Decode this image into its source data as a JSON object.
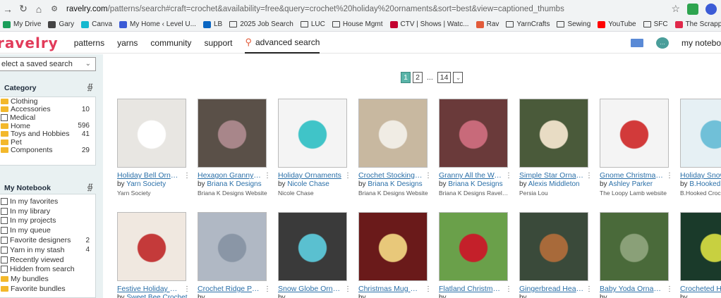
{
  "browser": {
    "url_host": "ravelry.com",
    "url_path": "/patterns/search#craft=crochet&availability=free&query=crochet%20holiday%20ornaments&sort=best&view=captioned_thumbs"
  },
  "bookmarks": [
    {
      "label": "My Drive",
      "color": "#1a9e5a",
      "folder": false
    },
    {
      "label": "Gary",
      "color": "#444",
      "folder": false
    },
    {
      "label": "Canva",
      "color": "#15b8cf",
      "folder": false
    },
    {
      "label": "My Home ‹ Level U...",
      "color": "#3b5bd6",
      "folder": false
    },
    {
      "label": "LB",
      "color": "#0a66c2",
      "folder": false
    },
    {
      "label": "2025 Job Search",
      "color": "",
      "folder": true
    },
    {
      "label": "LUC",
      "color": "",
      "folder": true
    },
    {
      "label": "House Mgmt",
      "color": "",
      "folder": true
    },
    {
      "label": "CTV | Shows | Watc...",
      "color": "#c3002f",
      "folder": false
    },
    {
      "label": "Rav",
      "color": "#e25b3a",
      "folder": false
    },
    {
      "label": "YarnCrafts",
      "color": "",
      "folder": true
    },
    {
      "label": "Sewing",
      "color": "",
      "folder": true
    },
    {
      "label": "YouTube",
      "color": "#ff0000",
      "folder": false
    },
    {
      "label": "SFC",
      "color": "",
      "folder": true
    },
    {
      "label": "The Scrappy Flower...",
      "color": "#e0284a",
      "folder": false
    }
  ],
  "header": {
    "logo": "ravelry",
    "nav": [
      "patterns",
      "yarns",
      "community",
      "support"
    ],
    "advanced_search": "advanced search",
    "notebook": "my notebo"
  },
  "sidebar": {
    "saved_search_placeholder": "elect a saved search",
    "category_title": "Category",
    "categories": [
      {
        "label": "Clothing",
        "count": "",
        "icon": "folder"
      },
      {
        "label": "Accessories",
        "count": "10",
        "icon": "folder"
      },
      {
        "label": "Medical",
        "count": "",
        "icon": "checkbox"
      },
      {
        "label": "Home",
        "count": "596",
        "icon": "folder"
      },
      {
        "label": "Toys and Hobbies",
        "count": "41",
        "icon": "folder"
      },
      {
        "label": "Pet",
        "count": "",
        "icon": "folder"
      },
      {
        "label": "Components",
        "count": "29",
        "icon": "folder"
      }
    ],
    "notebook_title": "My Notebook",
    "notebook_items": [
      {
        "label": "In my favorites",
        "count": "",
        "icon": "checkbox"
      },
      {
        "label": "In my library",
        "count": "",
        "icon": "checkbox"
      },
      {
        "label": "In my projects",
        "count": "",
        "icon": "checkbox"
      },
      {
        "label": "In my queue",
        "count": "",
        "icon": "checkbox"
      },
      {
        "label": "Favorite designers",
        "count": "2",
        "icon": "checkbox"
      },
      {
        "label": "Yarn in my stash",
        "count": "4",
        "icon": "checkbox"
      },
      {
        "label": "Recently viewed",
        "count": "",
        "icon": "checkbox"
      },
      {
        "label": "Hidden from search",
        "count": "",
        "icon": "checkbox"
      },
      {
        "label": "My bundles",
        "count": "",
        "icon": "folder"
      },
      {
        "label": "Favorite bundles",
        "count": "",
        "icon": "folder"
      }
    ]
  },
  "pagination": {
    "pages": [
      "1",
      "2"
    ],
    "ellipsis": "...",
    "last": "14"
  },
  "patterns": [
    {
      "title": "Holiday Bell Ornament",
      "by": "by",
      "designer": "Yarn Society",
      "source": "Yarn Society",
      "bg": "#e8e6e2",
      "fg": "#ffffff"
    },
    {
      "title": "Hexagon Granny Orn...",
      "by": "by",
      "designer": "Briana K Designs",
      "source": "Briana K Designs Website",
      "bg": "#5a5048",
      "fg": "#a8868a"
    },
    {
      "title": "Holiday Ornaments",
      "by": "by",
      "designer": "Nicole Chase",
      "source": "Nicole Chase",
      "bg": "#f4f4f4",
      "fg": "#40c4c8"
    },
    {
      "title": "Crochet Stocking + G...",
      "by": "by",
      "designer": "Briana K Designs",
      "source": "Briana K Designs Website",
      "bg": "#c8b8a0",
      "fg": "#f0ece4"
    },
    {
      "title": "Granny All the Way Or...",
      "by": "by",
      "designer": "Briana K Designs",
      "source": "Briana K Designs Ravelry ...",
      "bg": "#6a3a3a",
      "fg": "#c86a7a"
    },
    {
      "title": "Simple Star Ornaments",
      "by": "by",
      "designer": "Alexis Middleton",
      "source": "Persia Lou",
      "bg": "#4a5a3a",
      "fg": "#e8dcc4"
    },
    {
      "title": "Gnome Christmas Tre...",
      "by": "by",
      "designer": "Ashley Parker",
      "source": "The Loopy Lamb website",
      "bg": "#f4f4f4",
      "fg": "#d23a3a"
    },
    {
      "title": "Holiday Snowfl...",
      "by": "by",
      "designer": "B.Hooked Cr...",
      "source": "B.Hooked Croche...",
      "bg": "#e6f0f4",
      "fg": "#70c0d8"
    },
    {
      "title": "Festive Holiday Bauble",
      "by": "by",
      "designer": "Sweet Bee Crochet",
      "source": "",
      "bg": "#f0e8e0",
      "fg": "#c43a3a"
    },
    {
      "title": "Crochet Ridge Pumpkin",
      "by": "by",
      "designer": "",
      "source": "",
      "bg": "#b0b8c4",
      "fg": "#8a96a6"
    },
    {
      "title": "Snow Globe Ornaments",
      "by": "by",
      "designer": "",
      "source": "",
      "bg": "#3a3a3a",
      "fg": "#5ac0d0"
    },
    {
      "title": "Christmas Mug Orna...",
      "by": "by",
      "designer": "",
      "source": "",
      "bg": "#6a1a1a",
      "fg": "#e8c87a"
    },
    {
      "title": "Flatland Christmas Ba...",
      "by": "by",
      "designer": "",
      "source": "",
      "bg": "#6aa04a",
      "fg": "#c4202a"
    },
    {
      "title": "Gingerbread Heart Or...",
      "by": "by",
      "designer": "",
      "source": "",
      "bg": "#3a4a3a",
      "fg": "#a86a3a"
    },
    {
      "title": "Baby Yoda Ornament",
      "by": "by",
      "designer": "",
      "source": "",
      "bg": "#4a6a3a",
      "fg": "#8aa078"
    },
    {
      "title": "Crocheted Holi...",
      "by": "by",
      "designer": "",
      "source": "",
      "bg": "#1a3a2a",
      "fg": "#c8d040"
    }
  ]
}
